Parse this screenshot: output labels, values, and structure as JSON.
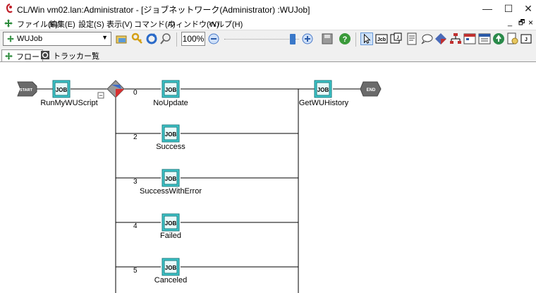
{
  "window": {
    "title": "CL/Win vm02.lan:Administrator - [ジョブネットワーク(Administrator) :WUJob]",
    "minimize": "—",
    "maximize": "☐",
    "close": "✕",
    "restore": "🗗",
    "doc_close": "×"
  },
  "menu": {
    "items": [
      "ファイル(F)",
      "編集(E)",
      "設定(S)",
      "表示(V)",
      "コマンド(A)",
      "ウィンドウ(W)",
      "ヘルプ(H)"
    ]
  },
  "toolbar": {
    "job_select_value": "WUJob",
    "zoom_value": "100%",
    "zoom_level": 0.9
  },
  "tabs": [
    {
      "label": "フロー",
      "active": true
    },
    {
      "label": "トラッカー覧",
      "active": false
    }
  ],
  "flow": {
    "start_label": "START",
    "end_label": "END",
    "job_icon_text": "JOB",
    "nodes": [
      {
        "label": "RunMyWUScript"
      },
      {
        "label": "NoUpdate",
        "branch": "0"
      },
      {
        "label": "Success",
        "branch": "2"
      },
      {
        "label": "SuccessWithError",
        "branch": "3"
      },
      {
        "label": "Failed",
        "branch": "4"
      },
      {
        "label": "Canceled",
        "branch": "5"
      },
      {
        "label": "GetWUHistory"
      }
    ],
    "collapse_symbol": "−"
  }
}
